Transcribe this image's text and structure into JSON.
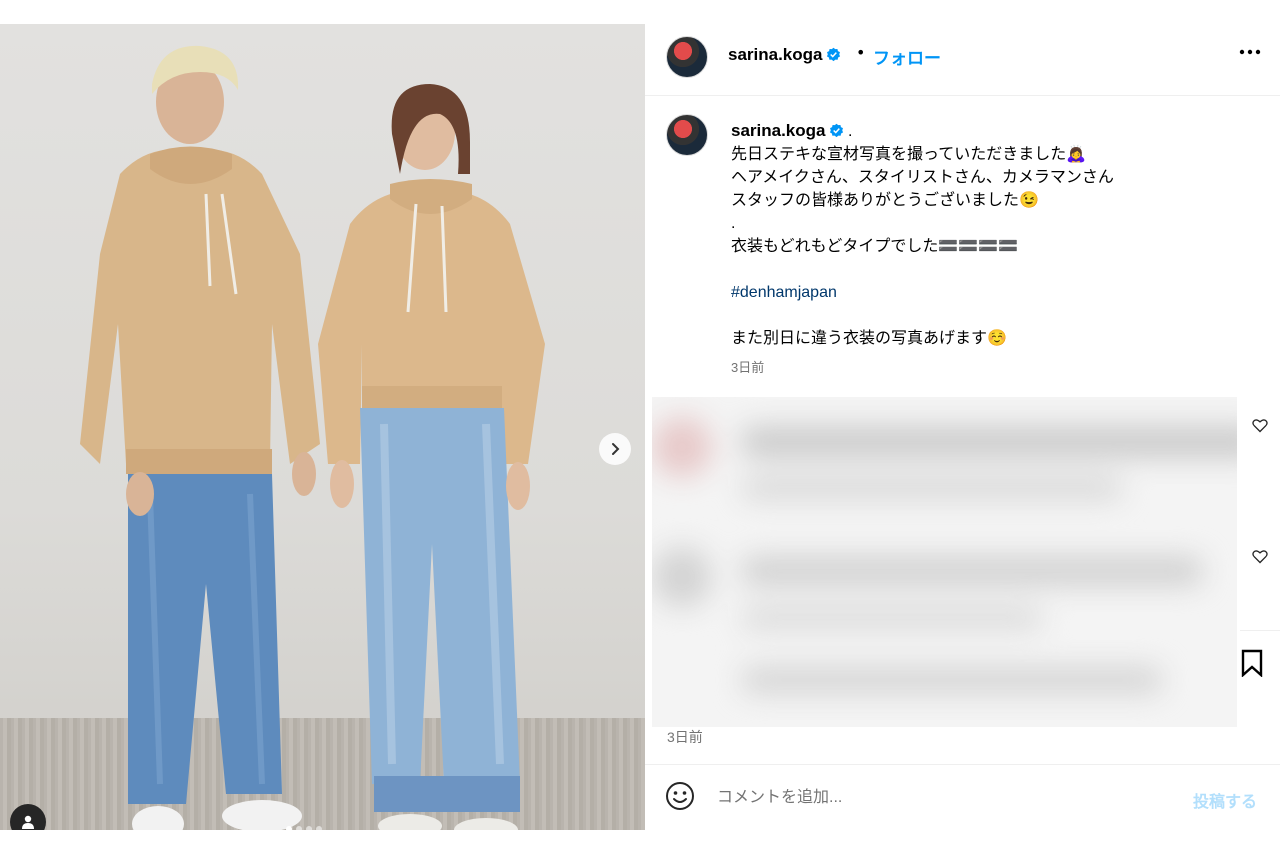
{
  "post": {
    "username": "sarina.koga",
    "separator": "•",
    "follow_label": "フォロー",
    "more_icon": "more-horizontal-icon",
    "verified_icon": "verified-badge-icon"
  },
  "media": {
    "next_icon": "chevron-right-icon",
    "user_tag_icon": "user-tag-icon",
    "carousel_total": 4,
    "carousel_active": 1
  },
  "caption": {
    "username": "sarina.koga",
    "trailing": ".",
    "lines": [
      "先日ステキな宣材写真を撮っていただきました🙇‍♀️",
      "ヘアメイクさん、スタイリストさん、カメラマンさん",
      "スタッフの皆様ありがとうございました😉",
      ".",
      "衣装もどれもどタイプでした🟰🟰🟰🟰"
    ],
    "hashtag": "#denhamjapan",
    "last_line": "また別日に違う衣装の写真あげます☺️",
    "time": "3日前"
  },
  "actions": {
    "like_icon": "heart-icon",
    "save_icon": "bookmark-icon",
    "post_time": "3日前"
  },
  "comment": {
    "emoji_icon": "emoji-icon",
    "placeholder": "コメントを追加...",
    "submit_label": "投稿する"
  },
  "colors": {
    "link": "#0095f6",
    "hashtag": "#00376b",
    "muted": "#737373",
    "submit_disabled": "#b2dffc"
  }
}
